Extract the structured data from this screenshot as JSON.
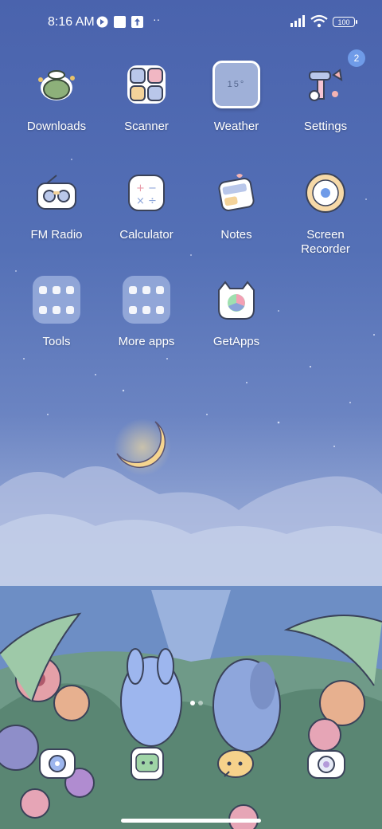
{
  "status_bar": {
    "time": "8:16 AM",
    "battery": "100",
    "icons": [
      "vpn-icon",
      "notification-square-icon",
      "upload-icon",
      "more-dots-icon",
      "signal-icon",
      "wifi-icon",
      "battery-icon"
    ]
  },
  "apps_row1": [
    {
      "label": "Downloads",
      "icon": "downloads-icon"
    },
    {
      "label": "Scanner",
      "icon": "scanner-icon"
    },
    {
      "label": "Weather",
      "icon": "weather-icon",
      "tile_text": "15°"
    },
    {
      "label": "Settings",
      "icon": "settings-icon",
      "badge": "2"
    }
  ],
  "apps_row2": [
    {
      "label": "FM Radio",
      "icon": "radio-icon"
    },
    {
      "label": "Calculator",
      "icon": "calculator-icon"
    },
    {
      "label": "Notes",
      "icon": "notes-icon"
    },
    {
      "label": "Screen Recorder",
      "icon": "screen-recorder-icon"
    }
  ],
  "apps_row3": [
    {
      "label": "Tools",
      "icon": "tools-folder-icon"
    },
    {
      "label": "More apps",
      "icon": "more-apps-folder-icon"
    },
    {
      "label": "GetApps",
      "icon": "getapps-icon"
    }
  ],
  "dock": [
    {
      "icon": "phone-icon"
    },
    {
      "icon": "messages-icon"
    },
    {
      "icon": "chat-icon"
    },
    {
      "icon": "camera-icon"
    }
  ],
  "colors": {
    "badge": "#6f9be8",
    "folder": "#bfcdf0"
  }
}
